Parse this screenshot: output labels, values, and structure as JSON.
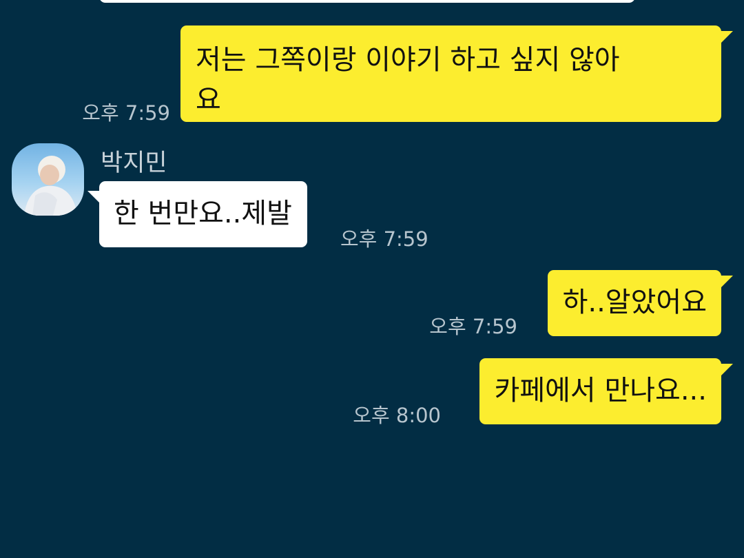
{
  "colors": {
    "background": "#022d44",
    "outgoing_bubble": "#fced2f",
    "incoming_bubble": "#ffffff",
    "timestamp": "#b7c5ce"
  },
  "messages": [
    {
      "direction": "outgoing",
      "lines": [
        "저는 그쪽이랑 이야기 하고 싶지 않아",
        "요"
      ],
      "time": "오후 7:59"
    },
    {
      "direction": "incoming",
      "sender": "박지민",
      "avatar_icon": "profile-photo",
      "text": "한 번만요..제발",
      "time": "오후 7:59"
    },
    {
      "direction": "outgoing",
      "text": "하..알았어요",
      "time": "오후 7:59"
    },
    {
      "direction": "outgoing",
      "text": "카페에서 만나요...",
      "time": "오후 8:00"
    }
  ]
}
